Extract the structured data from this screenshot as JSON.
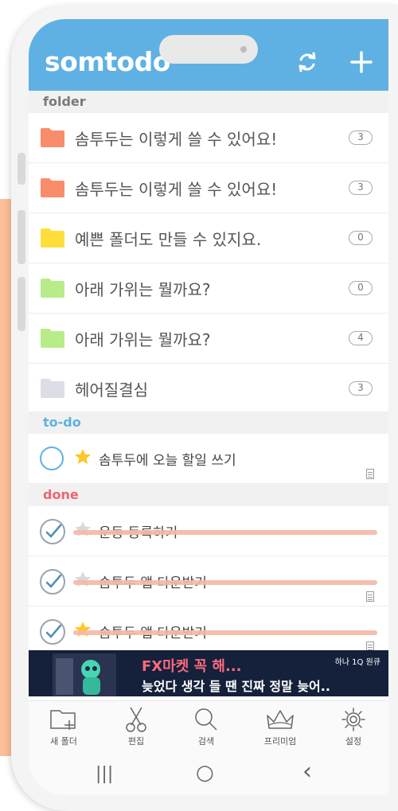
{
  "app": {
    "logo": "somtodo"
  },
  "header": {
    "sync_icon": "refresh-icon",
    "add_icon": "plus-icon",
    "color": "#5fb1e3"
  },
  "sections": {
    "folder": "folder",
    "todo": "to-do",
    "done": "done"
  },
  "folders": [
    {
      "name": "솜투두는 이렇게 쓸 수 있어요!",
      "count": "3",
      "color": "#f98d6b"
    },
    {
      "name": "솜투두는 이렇게 쓸 수 있어요!",
      "count": "3",
      "color": "#f98d6b"
    },
    {
      "name": "예쁜 폴더도 만들 수 있지요.",
      "count": "0",
      "color": "#ffde3b"
    },
    {
      "name": "아래 가위는 뭘까요?",
      "count": "0",
      "color": "#b8ec88"
    },
    {
      "name": "아래 가위는 뭘까요?",
      "count": "4",
      "color": "#b8ec88"
    },
    {
      "name": "헤어질결심",
      "count": "3",
      "color": "#dcdde6"
    }
  ],
  "todo": [
    {
      "text": "솜투두에 오늘 할일 쓰기",
      "starred": true
    }
  ],
  "done": [
    {
      "text": "운동 등록하기",
      "starred": false
    },
    {
      "text": "솜투두 앱 다운받기",
      "starred": false
    },
    {
      "text": "솜투두 앱 다운받기",
      "starred": true
    }
  ],
  "ad": {
    "line1": "FX마켓 꼭 해...",
    "line2": "늦었다 생각 들 땐 진짜 정말 늦어..",
    "brand": "하나 1Q 원큐"
  },
  "bottom_nav": [
    {
      "label": "새 폴더",
      "icon": "new-folder-icon"
    },
    {
      "label": "편집",
      "icon": "scissors-icon"
    },
    {
      "label": "검색",
      "icon": "search-icon"
    },
    {
      "label": "프리미엄",
      "icon": "crown-icon"
    },
    {
      "label": "설정",
      "icon": "gear-icon"
    }
  ],
  "system_nav": {
    "recents": "|||",
    "home": "○",
    "back": "‹"
  }
}
